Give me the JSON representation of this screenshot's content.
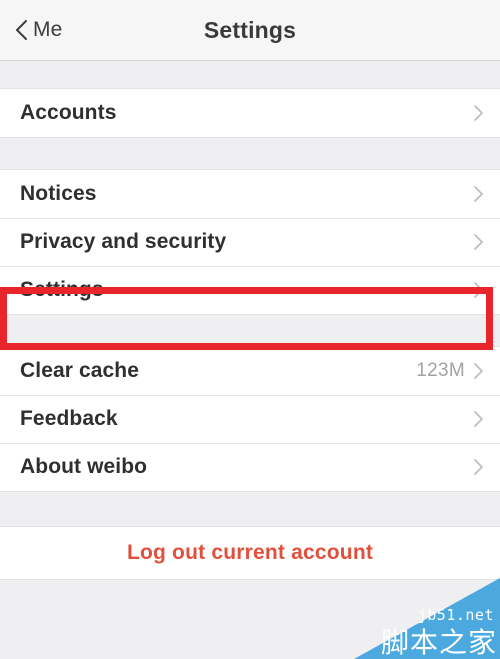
{
  "header": {
    "back_label": "Me",
    "back_icon": "chevron-left-icon",
    "title": "Settings"
  },
  "groups": [
    {
      "id": "accounts-group",
      "rows": [
        {
          "label": "Accounts",
          "value": "",
          "chevron": "chevron-right-icon"
        }
      ]
    },
    {
      "id": "main-group",
      "rows": [
        {
          "label": "Notices",
          "value": "",
          "chevron": "chevron-right-icon"
        },
        {
          "label": "Privacy and security",
          "value": "",
          "chevron": "chevron-right-icon"
        },
        {
          "label": "Settings",
          "value": "",
          "chevron": "chevron-right-icon"
        }
      ]
    },
    {
      "id": "support-group",
      "rows": [
        {
          "label": "Clear cache",
          "value": "123M",
          "chevron": "chevron-right-icon"
        },
        {
          "label": "Feedback",
          "value": "",
          "chevron": "chevron-right-icon"
        },
        {
          "label": "About weibo",
          "value": "",
          "chevron": "chevron-right-icon"
        }
      ]
    }
  ],
  "logout": {
    "label": "Log out current account"
  },
  "annotation": {
    "target": "Settings",
    "color": "#e8252a"
  },
  "watermark": {
    "url": "jb51.net",
    "text": "脚本之家",
    "color": "#4ba9e0"
  },
  "colors": {
    "accent_red": "#e8252a",
    "logout_red": "#e1503c",
    "page_bg": "#efeff1",
    "row_bg": "#ffffff",
    "value_gray": "#a2a2a6"
  }
}
